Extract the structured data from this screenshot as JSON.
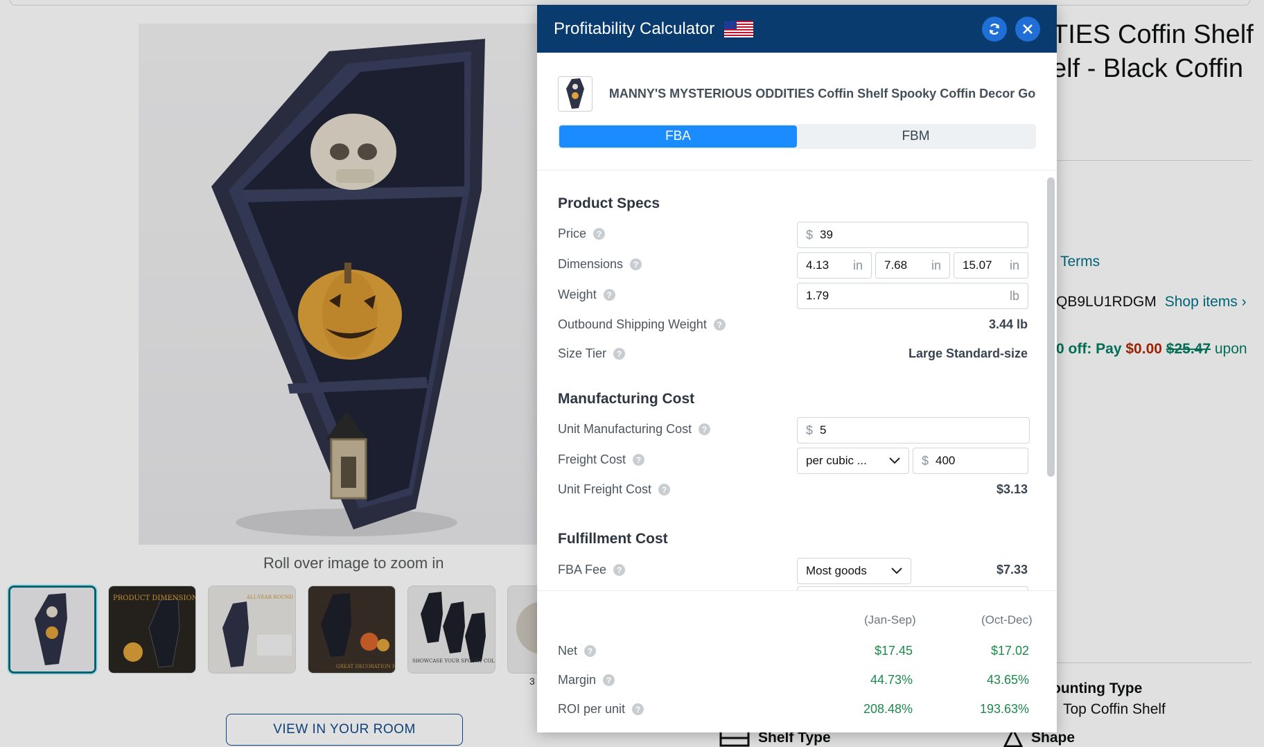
{
  "background": {
    "zoom_hint": "Roll over image to zoom in",
    "thumb_count": "3",
    "view_room": "VIEW IN YOUR ROOM",
    "title_line1": "TIES Coffin Shelf",
    "title_line2": "elf - Black Coffin",
    "terms": "Terms",
    "asin_fragment": "QB9LU1RDGM",
    "shop_items": "Shop items ›",
    "coupon": {
      "prefix": "0 off: Pay",
      "pay": "$0.00",
      "strike": "$25.47",
      "suffix": "upon"
    },
    "mounting_label": "ounting Type",
    "mounting_value": "Top Coffin Shelf",
    "shelf_type": "Shelf Type",
    "shape": "Shape",
    "thumbnails": [
      {
        "caption": ""
      },
      {
        "caption": "PRODUCT DIMENSIONS"
      },
      {
        "caption": "ALL-YEAR ROUND FURNITURE PIECE"
      },
      {
        "caption": "GREAT DECORATION FOR YOUR TABLETOP"
      },
      {
        "caption": "SHOWCASE YOUR SPOOKY COLLECTION"
      }
    ]
  },
  "calculator": {
    "title": "Profitability Calculator",
    "product_title": "MANNY'S MYSTERIOUS ODDITIES Coffin Shelf Spooky Coffin Decor Go...",
    "tabs": [
      {
        "label": "FBA",
        "active": true
      },
      {
        "label": "FBM",
        "active": false
      }
    ],
    "product_specs": {
      "heading": "Product Specs",
      "price_label": "Price",
      "price_currency": "$",
      "price_value": "39",
      "dimensions_label": "Dimensions",
      "dim_unit": "in",
      "dim1": "4.13",
      "dim2": "7.68",
      "dim3": "15.07",
      "weight_label": "Weight",
      "weight_value": "1.79",
      "weight_unit": "lb",
      "outbound_label": "Outbound Shipping Weight",
      "outbound_value": "3.44 lb",
      "size_tier_label": "Size Tier",
      "size_tier_value": "Large Standard-size"
    },
    "manufacturing": {
      "heading": "Manufacturing Cost",
      "unit_cost_label": "Unit Manufacturing Cost",
      "unit_cost_currency": "$",
      "unit_cost_value": "5",
      "freight_label": "Freight Cost",
      "freight_mode": "per cubic ...",
      "freight_currency": "$",
      "freight_value": "400",
      "unit_freight_label": "Unit Freight Cost",
      "unit_freight_value": "$3.13"
    },
    "fulfillment": {
      "heading": "Fulfillment Cost",
      "fba_fee_label": "FBA Fee",
      "fba_category": "Most goods",
      "fba_fee_value": "$7.33"
    },
    "summary": {
      "col1": "(Jan-Sep)",
      "col2": "(Oct-Dec)",
      "rows": [
        {
          "label": "Net",
          "v1": "$17.45",
          "v2": "$17.02"
        },
        {
          "label": "Margin",
          "v1": "44.73%",
          "v2": "43.65%"
        },
        {
          "label": "ROI per unit",
          "v1": "208.48%",
          "v2": "193.63%"
        }
      ]
    }
  },
  "colors": {
    "header_bg": "#0a3b6e",
    "tab_active": "#1a8cff",
    "positive": "#1c8a4a"
  }
}
